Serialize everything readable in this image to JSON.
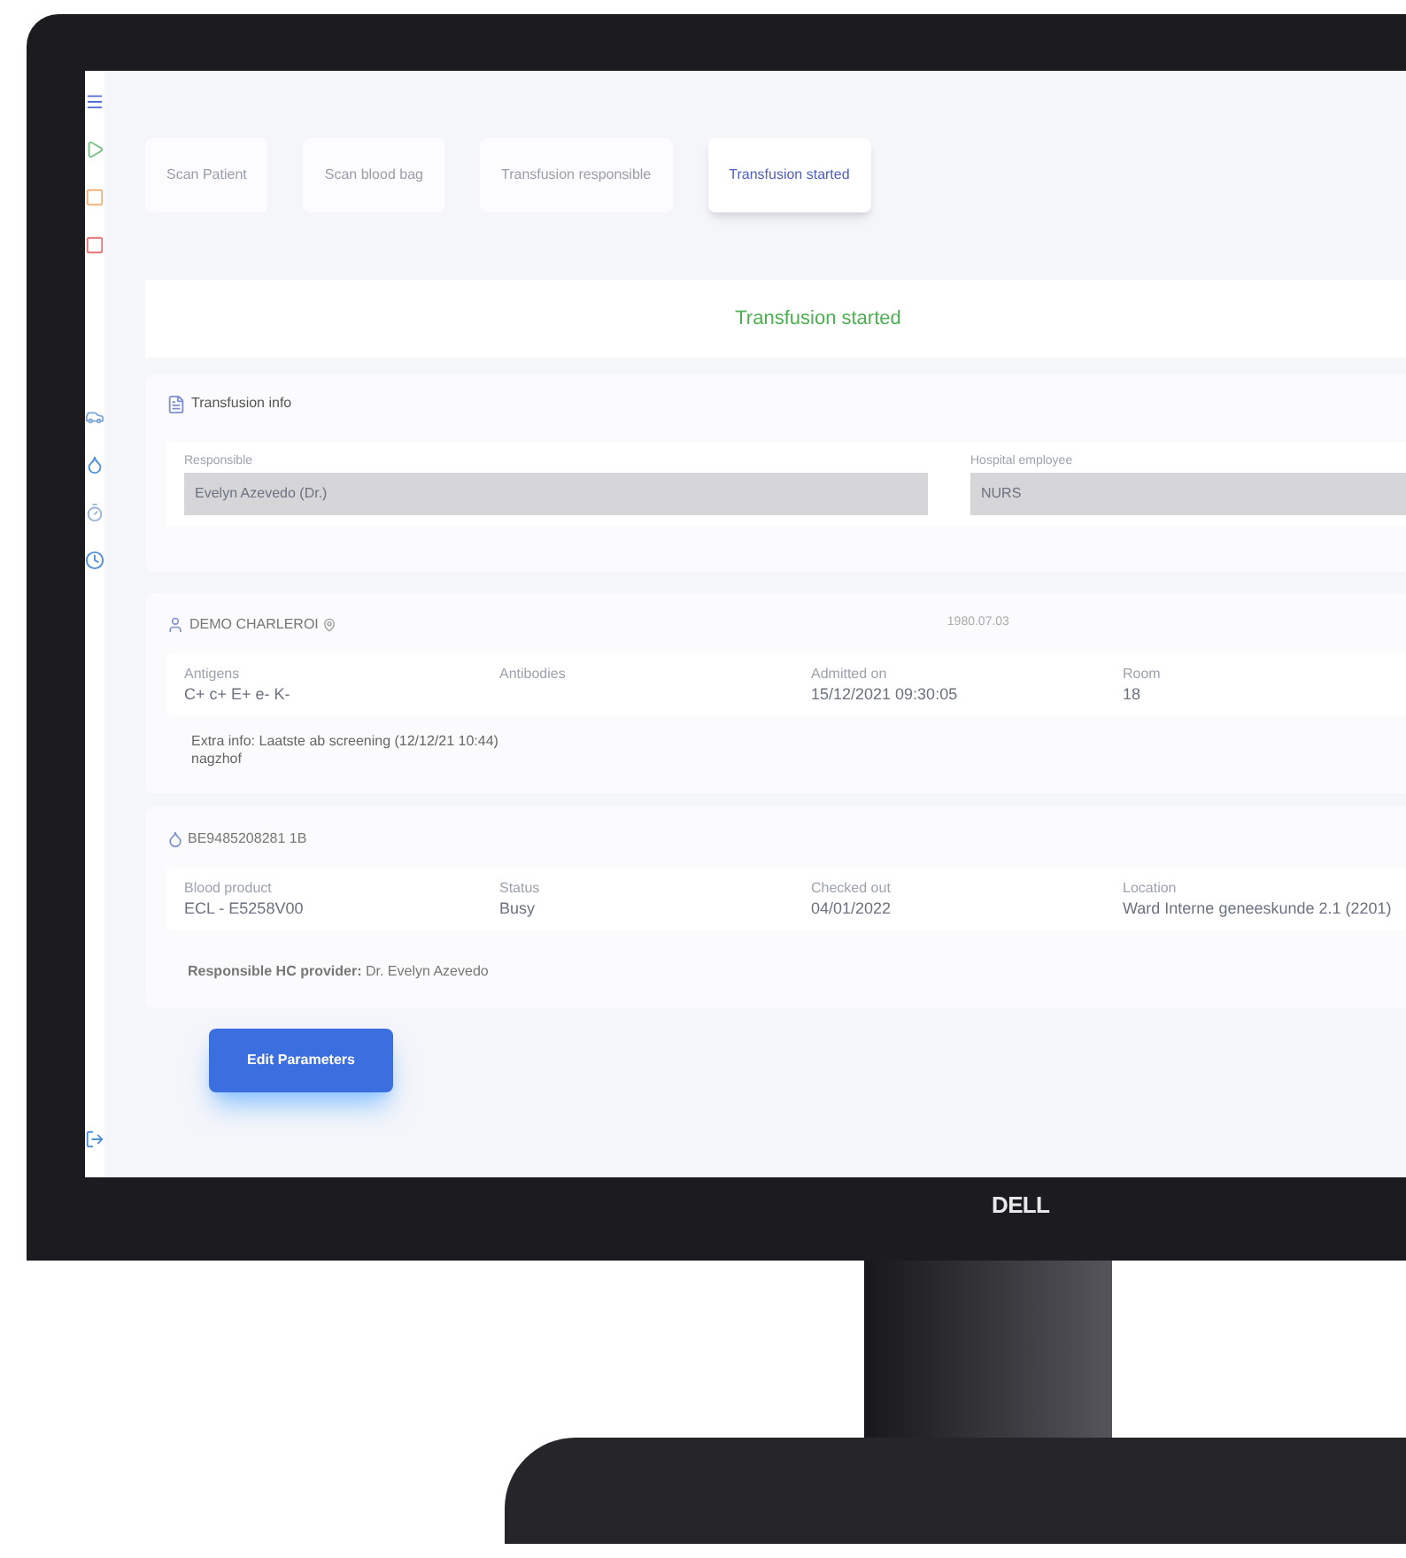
{
  "brand": "DELL",
  "steps": [
    {
      "label": "Scan Patient",
      "selected": false
    },
    {
      "label": "Scan blood bag",
      "selected": false
    },
    {
      "label": "Transfusion responsible",
      "selected": false
    },
    {
      "label": "Transfusion started",
      "selected": true
    }
  ],
  "status_banner": "Transfusion started",
  "transfusion_info": {
    "title": "Transfusion info",
    "fields": [
      {
        "label": "Responsible",
        "value": "Evelyn Azevedo (Dr.)"
      },
      {
        "label": "Hospital employee",
        "value": "NURS"
      }
    ]
  },
  "patient": {
    "name": "DEMO CHARLEROI",
    "birth_date": "1980.07.03",
    "fields": [
      {
        "label": "Antigens",
        "value": "C+ c+ E+ e- K-"
      },
      {
        "label": "Antibodies"
      },
      {
        "label": "Admitted on",
        "value": "15/12/2021 09:30:05"
      },
      {
        "label": "Room",
        "value": "18"
      }
    ],
    "extra_info": [
      "Extra info: Laatste ab screening (12/12/21 10:44)",
      "nagzhof"
    ]
  },
  "blood_bag": {
    "id": "BE9485208281 1B",
    "fields": [
      {
        "label": "Blood product",
        "value": "ECL - E5258V00"
      },
      {
        "label": "Status",
        "value": "Busy"
      },
      {
        "label": "Checked out",
        "value": "04/01/2022"
      },
      {
        "label": "Location",
        "value": "Ward Interne geneeskunde 2.1 (2201)"
      }
    ],
    "responsible": "**Responsible HC provider:** Dr. Evelyn Azevedo"
  },
  "edit_button": "Edit Parameters"
}
